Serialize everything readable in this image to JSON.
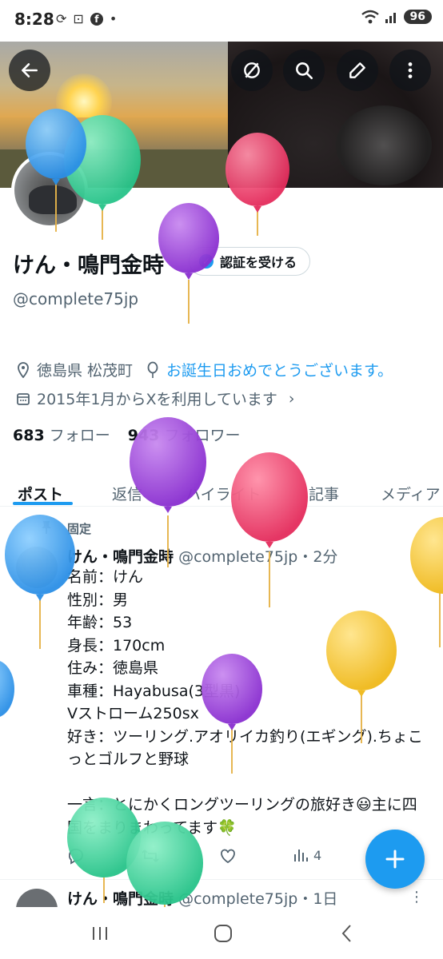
{
  "status_bar": {
    "time": "8:28",
    "battery": "96"
  },
  "header": {
    "back_icon": "arrow-left-icon",
    "actions": [
      "grok-icon",
      "search-icon",
      "edit-icon",
      "more-vertical-icon"
    ]
  },
  "profile": {
    "display_name": "けん・鳴門金時",
    "handle": "@complete75jp",
    "verify_button": "認証を受ける",
    "location": "徳島県 松茂町",
    "birthday": "お誕生日おめでとうございます。",
    "joined": "2015年1月からXを利用しています",
    "following_count": "683",
    "following_label": "フォロー",
    "followers_count": "943",
    "followers_label": "フォロワー"
  },
  "tabs": [
    "ポスト",
    "返信",
    "ハイライト",
    "記事",
    "メディア"
  ],
  "pinned_post": {
    "pinned_label": "固定",
    "author": "けん・鳴門金時",
    "meta": "@complete75jp・2分",
    "body": "名前：けん\n性別：男\n年齢：53\n身長：170cm\n住み：徳島県\n車種：Hayabusa(3型黒)\nVストローム250sx\n好き：ツーリング.アオリイカ釣り(エギング).ちょこっとゴルフと野球\n\n一言：とにかくロングツーリングの旅好き😃主に四国をまりまわってます🍀",
    "views": "4"
  },
  "next_post": {
    "author": "けん・鳴門金時",
    "meta": "@complete75jp・1日"
  },
  "colors": {
    "accent": "#1d9bf0",
    "balloon_blue": "#3aa0f0",
    "balloon_green": "#36d49a",
    "balloon_purple": "#9b3fd8",
    "balloon_pink": "#ec3c6a",
    "balloon_yellow": "#f5c826"
  }
}
